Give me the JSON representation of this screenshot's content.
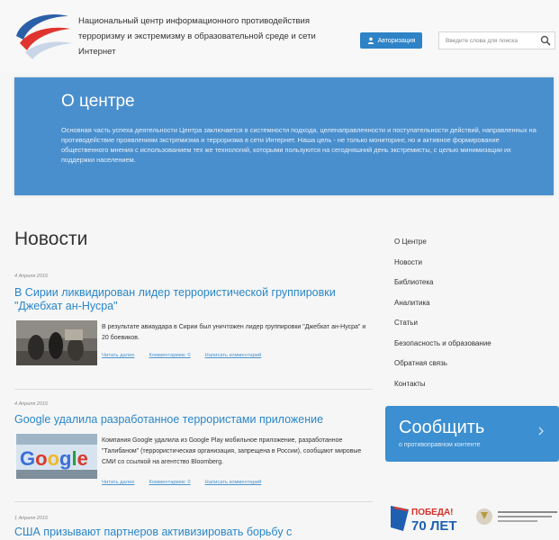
{
  "header": {
    "title": "Национальный центр информационного противодействия терроризму и экстремизму в образовательной среде и сети Интернет",
    "auth_label": "Авторизация",
    "search_placeholder": "Введите слова для поиска"
  },
  "about": {
    "heading": "О центре",
    "text": "Основная часть успеха деятельности Центра заключается в системности подхода, целенаправленности и поступательности действий, направленных на противодействие проявлениям экстремизма и терроризма в сети Интернет. Наша цель - не только мониторинг, но и активное формирование общественного мнения с использованием тех же технологий, которыми пользуются на сегодняшний день экстремисты, с целью минимизации их поддержки населением."
  },
  "news": {
    "title": "Новости",
    "items": [
      {
        "date": "4 Апреля 2016",
        "headline": "В Сирии ликвидирован лидер террористической группировки \"Джебхат ан-Нусра\"",
        "text": "В результате авиаудара в Сирии был уничтожен лидер группировки \"Джебхат ан-Нусра\" и 20 боевиков.",
        "read_more": "Читать далее",
        "comments": "Комментариев: 0",
        "write_comment": "Написать комментарий"
      },
      {
        "date": "4 Апреля 2016",
        "headline": "Google удалила разработанное террористами приложение",
        "text": "Компания Google удалила из Google Play мобильное приложение, разработанное \"Талибаном\" (террористическая организация, запрещена в России), сообщают мировые СМИ со ссылкой на агентство Bloomberg.",
        "read_more": "Читать далее",
        "comments": "Комментариев: 0",
        "write_comment": "Написать комментарий",
        "thumb_text": "Google"
      },
      {
        "date": "1 Апреля 2016",
        "headline": "США призывают партнеров активизировать борьбу с"
      }
    ]
  },
  "sidebar": {
    "items": [
      "О Центре",
      "Новости",
      "Библиотека",
      "Аналитика",
      "Статьи",
      "Безопасность и образование",
      "Обратная связь",
      "Контакты"
    ],
    "report_big": "Сообщить",
    "report_small": "о противоправном контенте"
  },
  "banners": {
    "victory_line1": "ПОБЕДА!",
    "victory_line2": "70 ЛЕТ",
    "ministry": "МИНИСТЕРСТВО ОБРАЗОВАНИЯ И НАУКИ РОССИЙСКОЙ ФЕДЕРАЦИИ"
  },
  "colors": {
    "accent": "#2a86c8",
    "banner": "#4a8fcd",
    "button": "#3c8fd0"
  }
}
